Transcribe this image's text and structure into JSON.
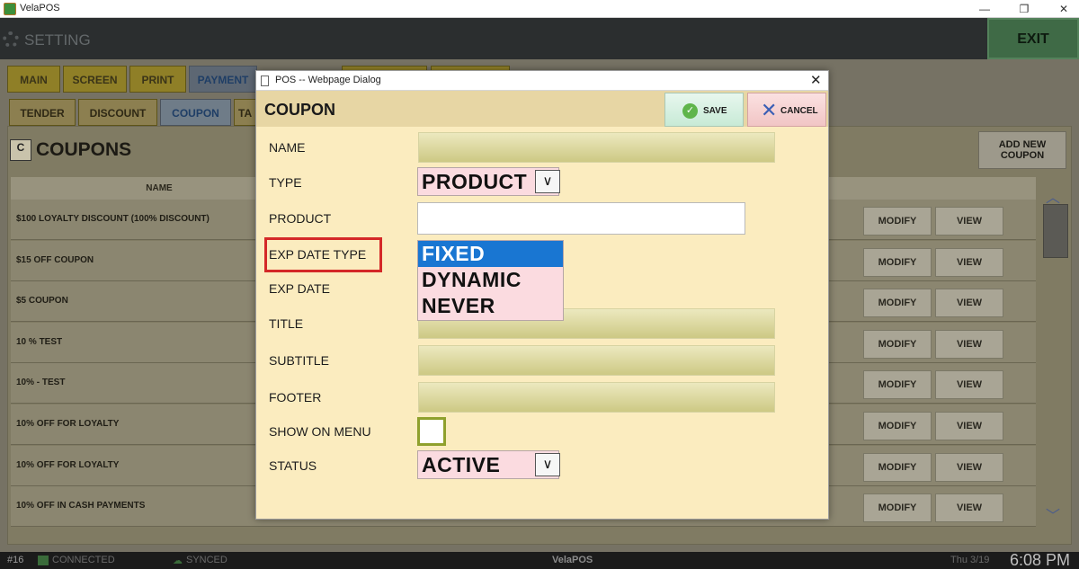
{
  "window": {
    "title": "VelaPOS",
    "minimize": "—",
    "restore": "❐",
    "close": "✕"
  },
  "header": {
    "title": "SETTING",
    "exit_label": "EXIT"
  },
  "main_tabs": [
    {
      "label": "MAIN"
    },
    {
      "label": "SCREEN"
    },
    {
      "label": "PRINT"
    },
    {
      "label": "PAYMENT"
    }
  ],
  "sub_tabs": [
    {
      "label": "TENDER"
    },
    {
      "label": "DISCOUNT"
    },
    {
      "label": "COUPON"
    },
    {
      "label": "TA"
    }
  ],
  "coupons": {
    "logo": "C",
    "title": "COUPONS",
    "add_label": "ADD NEW COUPON",
    "column_name": "NAME",
    "modify_label": "MODIFY",
    "view_label": "VIEW",
    "rows": [
      {
        "name": "$100 LOYALTY DISCOUNT (100% DISCOUNT)"
      },
      {
        "name": "$15 OFF COUPON"
      },
      {
        "name": "$5 COUPON"
      },
      {
        "name": "10 % TEST"
      },
      {
        "name": "10% - TEST"
      },
      {
        "name": "10% OFF FOR LOYALTY"
      },
      {
        "name": "10% OFF FOR LOYALTY"
      },
      {
        "name": "10% OFF IN CASH PAYMENTS"
      }
    ]
  },
  "status_bar": {
    "number": "#16",
    "connected": "CONNECTED",
    "synced": "SYNCED",
    "brand": "VelaPOS",
    "date": "Thu 3/19",
    "time": "6:08 PM"
  },
  "dialog": {
    "window_title": "POS -- Webpage Dialog",
    "close": "✕",
    "title": "COUPON",
    "save_label": "SAVE",
    "cancel_label": "CANCEL",
    "labels": {
      "name": "NAME",
      "type": "TYPE",
      "product": "PRODUCT",
      "exp_date_type": "EXP DATE TYPE",
      "exp_date": "EXP DATE",
      "title": "TITLE",
      "subtitle": "SUBTITLE",
      "footer": "FOOTER",
      "show_on_menu": "SHOW ON MENU",
      "status": "STATUS"
    },
    "type_value": "PRODUCT",
    "exp_date_type_options": [
      "FIXED",
      "DYNAMIC",
      "NEVER"
    ],
    "exp_date_type_selected": "FIXED",
    "status_value": "ACTIVE",
    "show_on_menu_checked": false
  },
  "colors": {
    "dialog_bg": "#fbecbf",
    "selected_option": "#1976d2",
    "highlight_border": "#d42828"
  }
}
